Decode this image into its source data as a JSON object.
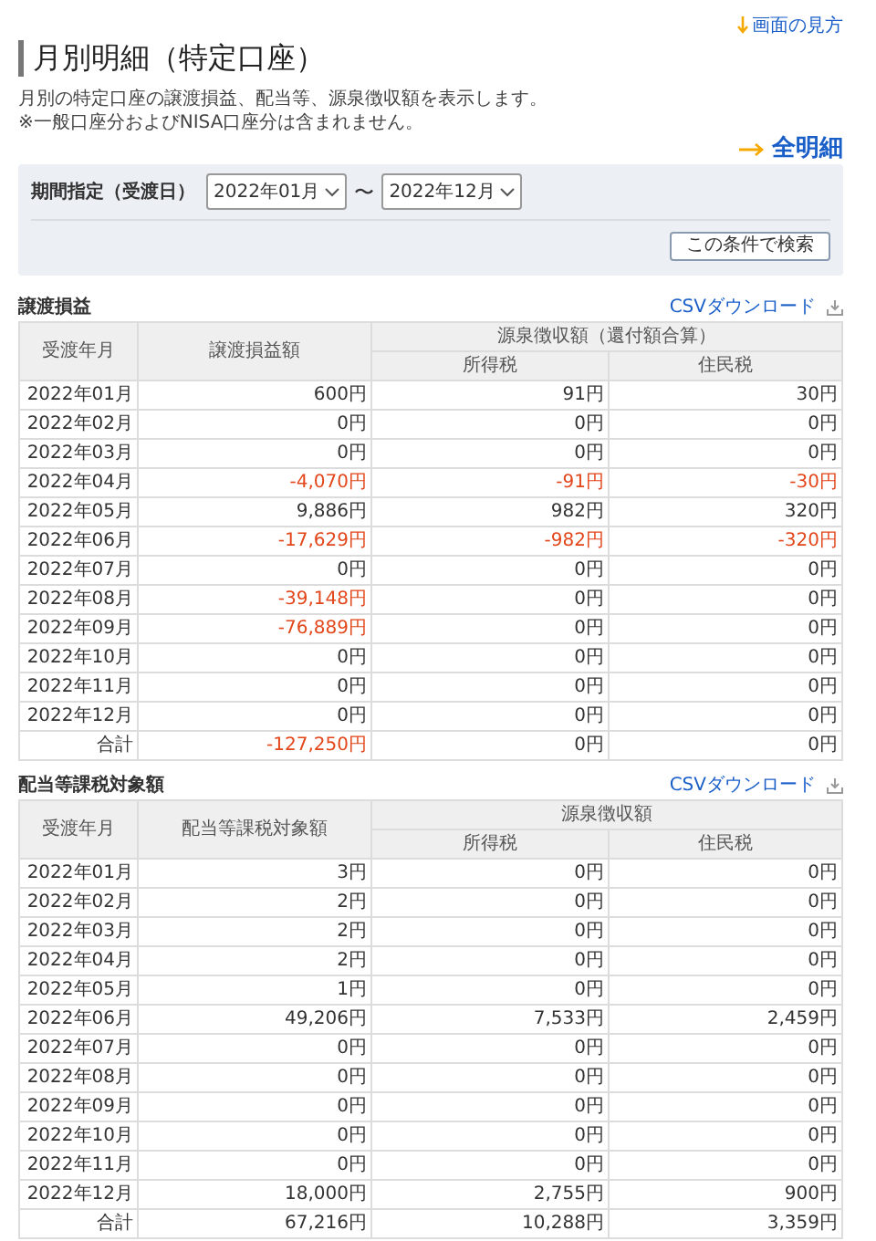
{
  "help_link": "画面の見方",
  "title": "月別明細（特定口座）",
  "description": [
    "月別の特定口座の譲渡損益、配当等、源泉徴収額を表示します。",
    "※一般口座分およびNISA口座分は含まれません。"
  ],
  "all_details_link": "全明細",
  "filter": {
    "label": "期間指定（受渡日）",
    "from": "2022年01月",
    "separator": "〜",
    "to": "2022年12月",
    "search_button": "この条件で検索"
  },
  "sections": [
    {
      "title": "譲渡損益",
      "csv_link": "CSVダウンロード",
      "columns": [
        "受渡年月",
        "譲渡損益額"
      ],
      "group_header": "源泉徴収額（還付額合算）",
      "sub_columns": [
        "所得税",
        "住民税"
      ],
      "rows": [
        {
          "cells": [
            {
              "text": "2022年01月",
              "negative": false
            },
            {
              "text": "600円",
              "negative": false
            },
            {
              "text": "91円",
              "negative": false
            },
            {
              "text": "30円",
              "negative": false
            }
          ]
        },
        {
          "cells": [
            {
              "text": "2022年02月",
              "negative": false
            },
            {
              "text": "0円",
              "negative": false
            },
            {
              "text": "0円",
              "negative": false
            },
            {
              "text": "0円",
              "negative": false
            }
          ]
        },
        {
          "cells": [
            {
              "text": "2022年03月",
              "negative": false
            },
            {
              "text": "0円",
              "negative": false
            },
            {
              "text": "0円",
              "negative": false
            },
            {
              "text": "0円",
              "negative": false
            }
          ]
        },
        {
          "cells": [
            {
              "text": "2022年04月",
              "negative": false
            },
            {
              "text": "-4,070円",
              "negative": true
            },
            {
              "text": "-91円",
              "negative": true
            },
            {
              "text": "-30円",
              "negative": true
            }
          ]
        },
        {
          "cells": [
            {
              "text": "2022年05月",
              "negative": false
            },
            {
              "text": "9,886円",
              "negative": false
            },
            {
              "text": "982円",
              "negative": false
            },
            {
              "text": "320円",
              "negative": false
            }
          ]
        },
        {
          "cells": [
            {
              "text": "2022年06月",
              "negative": false
            },
            {
              "text": "-17,629円",
              "negative": true
            },
            {
              "text": "-982円",
              "negative": true
            },
            {
              "text": "-320円",
              "negative": true
            }
          ]
        },
        {
          "cells": [
            {
              "text": "2022年07月",
              "negative": false
            },
            {
              "text": "0円",
              "negative": false
            },
            {
              "text": "0円",
              "negative": false
            },
            {
              "text": "0円",
              "negative": false
            }
          ]
        },
        {
          "cells": [
            {
              "text": "2022年08月",
              "negative": false
            },
            {
              "text": "-39,148円",
              "negative": true
            },
            {
              "text": "0円",
              "negative": false
            },
            {
              "text": "0円",
              "negative": false
            }
          ]
        },
        {
          "cells": [
            {
              "text": "2022年09月",
              "negative": false
            },
            {
              "text": "-76,889円",
              "negative": true
            },
            {
              "text": "0円",
              "negative": false
            },
            {
              "text": "0円",
              "negative": false
            }
          ]
        },
        {
          "cells": [
            {
              "text": "2022年10月",
              "negative": false
            },
            {
              "text": "0円",
              "negative": false
            },
            {
              "text": "0円",
              "negative": false
            },
            {
              "text": "0円",
              "negative": false
            }
          ]
        },
        {
          "cells": [
            {
              "text": "2022年11月",
              "negative": false
            },
            {
              "text": "0円",
              "negative": false
            },
            {
              "text": "0円",
              "negative": false
            },
            {
              "text": "0円",
              "negative": false
            }
          ]
        },
        {
          "cells": [
            {
              "text": "2022年12月",
              "negative": false
            },
            {
              "text": "0円",
              "negative": false
            },
            {
              "text": "0円",
              "negative": false
            },
            {
              "text": "0円",
              "negative": false
            }
          ]
        },
        {
          "cells": [
            {
              "text": "合計",
              "negative": false
            },
            {
              "text": "-127,250円",
              "negative": true
            },
            {
              "text": "0円",
              "negative": false
            },
            {
              "text": "0円",
              "negative": false
            }
          ]
        }
      ]
    },
    {
      "title": "配当等課税対象額",
      "csv_link": "CSVダウンロード",
      "columns": [
        "受渡年月",
        "配当等課税対象額"
      ],
      "group_header": "源泉徴収額",
      "sub_columns": [
        "所得税",
        "住民税"
      ],
      "rows": [
        {
          "cells": [
            {
              "text": "2022年01月",
              "negative": false
            },
            {
              "text": "3円",
              "negative": false
            },
            {
              "text": "0円",
              "negative": false
            },
            {
              "text": "0円",
              "negative": false
            }
          ]
        },
        {
          "cells": [
            {
              "text": "2022年02月",
              "negative": false
            },
            {
              "text": "2円",
              "negative": false
            },
            {
              "text": "0円",
              "negative": false
            },
            {
              "text": "0円",
              "negative": false
            }
          ]
        },
        {
          "cells": [
            {
              "text": "2022年03月",
              "negative": false
            },
            {
              "text": "2円",
              "negative": false
            },
            {
              "text": "0円",
              "negative": false
            },
            {
              "text": "0円",
              "negative": false
            }
          ]
        },
        {
          "cells": [
            {
              "text": "2022年04月",
              "negative": false
            },
            {
              "text": "2円",
              "negative": false
            },
            {
              "text": "0円",
              "negative": false
            },
            {
              "text": "0円",
              "negative": false
            }
          ]
        },
        {
          "cells": [
            {
              "text": "2022年05月",
              "negative": false
            },
            {
              "text": "1円",
              "negative": false
            },
            {
              "text": "0円",
              "negative": false
            },
            {
              "text": "0円",
              "negative": false
            }
          ]
        },
        {
          "cells": [
            {
              "text": "2022年06月",
              "negative": false
            },
            {
              "text": "49,206円",
              "negative": false
            },
            {
              "text": "7,533円",
              "negative": false
            },
            {
              "text": "2,459円",
              "negative": false
            }
          ]
        },
        {
          "cells": [
            {
              "text": "2022年07月",
              "negative": false
            },
            {
              "text": "0円",
              "negative": false
            },
            {
              "text": "0円",
              "negative": false
            },
            {
              "text": "0円",
              "negative": false
            }
          ]
        },
        {
          "cells": [
            {
              "text": "2022年08月",
              "negative": false
            },
            {
              "text": "0円",
              "negative": false
            },
            {
              "text": "0円",
              "negative": false
            },
            {
              "text": "0円",
              "negative": false
            }
          ]
        },
        {
          "cells": [
            {
              "text": "2022年09月",
              "negative": false
            },
            {
              "text": "0円",
              "negative": false
            },
            {
              "text": "0円",
              "negative": false
            },
            {
              "text": "0円",
              "negative": false
            }
          ]
        },
        {
          "cells": [
            {
              "text": "2022年10月",
              "negative": false
            },
            {
              "text": "0円",
              "negative": false
            },
            {
              "text": "0円",
              "negative": false
            },
            {
              "text": "0円",
              "negative": false
            }
          ]
        },
        {
          "cells": [
            {
              "text": "2022年11月",
              "negative": false
            },
            {
              "text": "0円",
              "negative": false
            },
            {
              "text": "0円",
              "negative": false
            },
            {
              "text": "0円",
              "negative": false
            }
          ]
        },
        {
          "cells": [
            {
              "text": "2022年12月",
              "negative": false
            },
            {
              "text": "18,000円",
              "negative": false
            },
            {
              "text": "2,755円",
              "negative": false
            },
            {
              "text": "900円",
              "negative": false
            }
          ]
        },
        {
          "cells": [
            {
              "text": "合計",
              "negative": false
            },
            {
              "text": "67,216円",
              "negative": false
            },
            {
              "text": "10,288円",
              "negative": false
            },
            {
              "text": "3,359円",
              "negative": false
            }
          ]
        }
      ]
    }
  ]
}
